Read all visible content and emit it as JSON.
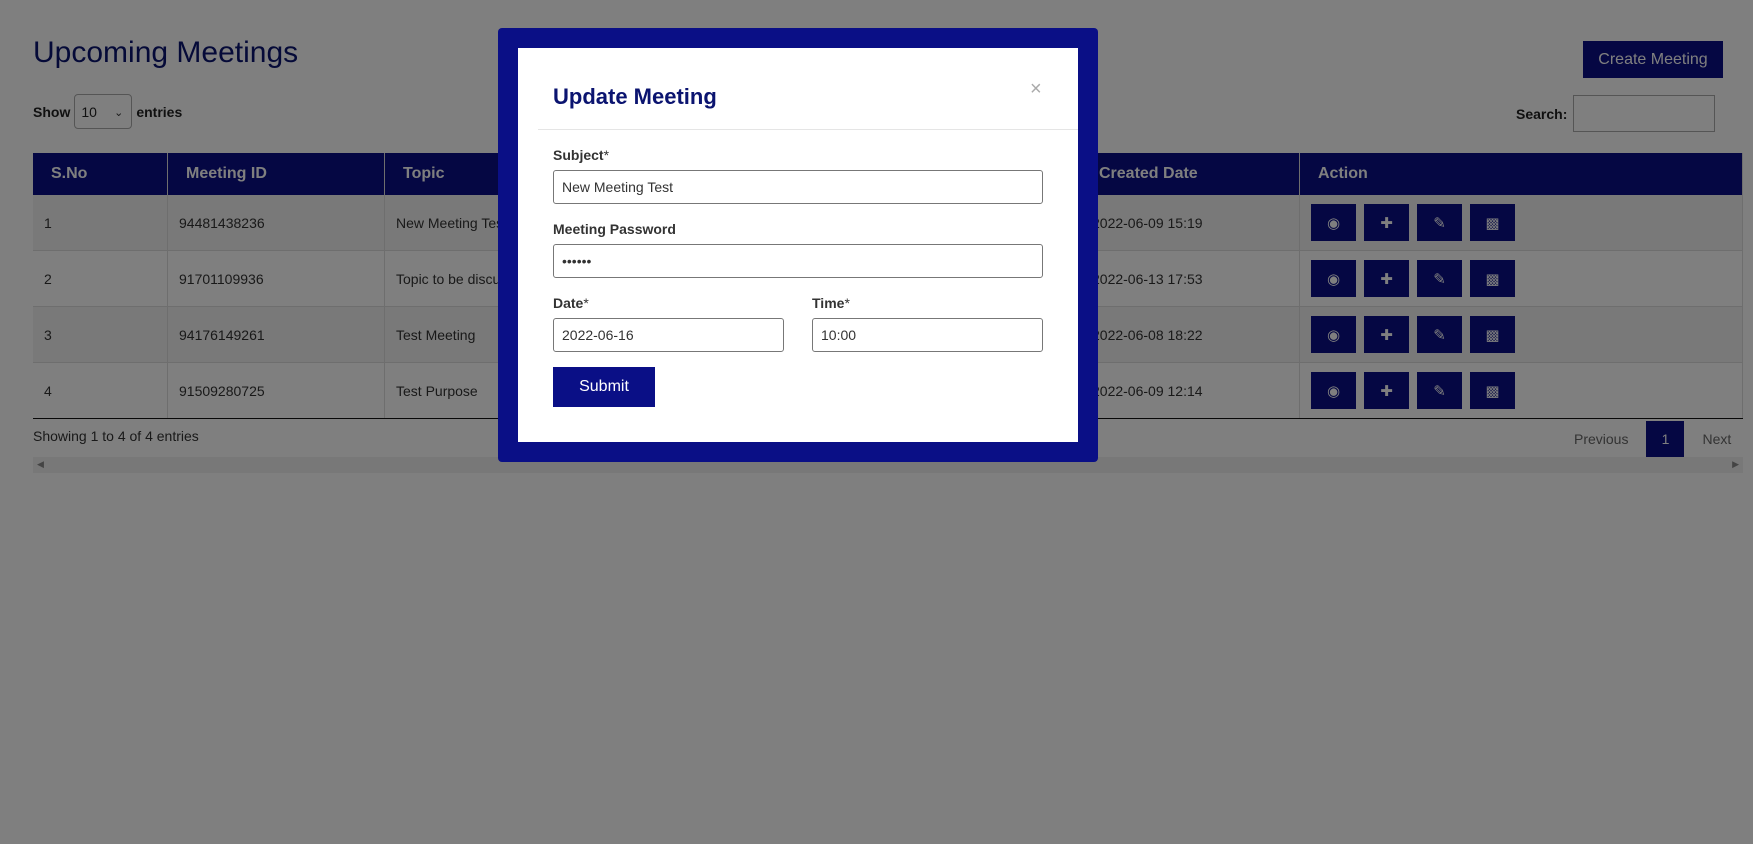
{
  "page": {
    "title": "Upcoming Meetings",
    "create_button": "Create Meeting",
    "show_label": "Show",
    "entries_label": "entries",
    "page_length": "10",
    "search_label": "Search:"
  },
  "table": {
    "headers": [
      "S.No",
      "Meeting ID",
      "Topic",
      "Created Date",
      "Action"
    ],
    "rows": [
      {
        "sno": "1",
        "meeting_id": "94481438236",
        "topic": "New Meeting Test",
        "created": "2022-06-09 15:19"
      },
      {
        "sno": "2",
        "meeting_id": "91701109936",
        "topic": "Topic to be discussed",
        "created": "2022-06-13 17:53"
      },
      {
        "sno": "3",
        "meeting_id": "94176149261",
        "topic": "Test Meeting",
        "created": "2022-06-08 18:22"
      },
      {
        "sno": "4",
        "meeting_id": "91509280725",
        "topic": "Test Purpose",
        "created": "2022-06-09 12:14"
      }
    ],
    "action_icons": [
      "eye-icon",
      "plus-icon",
      "edit-icon",
      "trash-icon"
    ]
  },
  "footer": {
    "info": "Showing 1 to 4 of 4 entries",
    "previous": "Previous",
    "current_page": "1",
    "next": "Next"
  },
  "modal": {
    "title": "Update Meeting",
    "close": "×",
    "subject_label": "Subject",
    "subject_value": "New Meeting Test",
    "password_label": "Meeting Password",
    "password_value": "••••••",
    "date_label": "Date",
    "date_value": "2022-06-16",
    "time_label": "Time",
    "time_value": "10:00",
    "required_mark": "*",
    "submit": "Submit"
  },
  "colors": {
    "brand": "#0a0f86",
    "title": "#0b1470"
  }
}
